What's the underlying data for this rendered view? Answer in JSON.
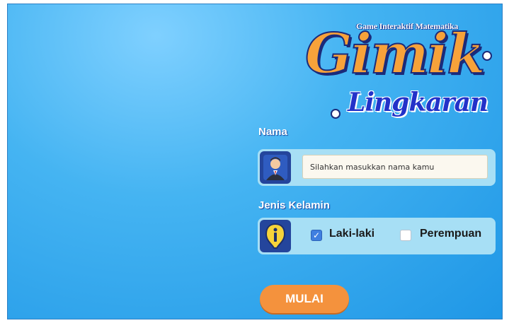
{
  "logo": {
    "subtitle": "Game Interaktif Matematika",
    "title": "Gimik",
    "subtitle2": "Lingkaran"
  },
  "name_section": {
    "label": "Nama",
    "placeholder": "Silahkan masukkan nama kamu",
    "value": ""
  },
  "gender_section": {
    "label": "Jenis Kelamin",
    "options": [
      {
        "label": "Laki-laki",
        "checked": true
      },
      {
        "label": "Perempuan",
        "checked": false
      }
    ]
  },
  "start_button": {
    "label": "MULAI"
  },
  "colors": {
    "background": "#45b4f2",
    "panel": "#a7dff5",
    "accent": "#f4923d",
    "icon_bg": "#24459c"
  }
}
